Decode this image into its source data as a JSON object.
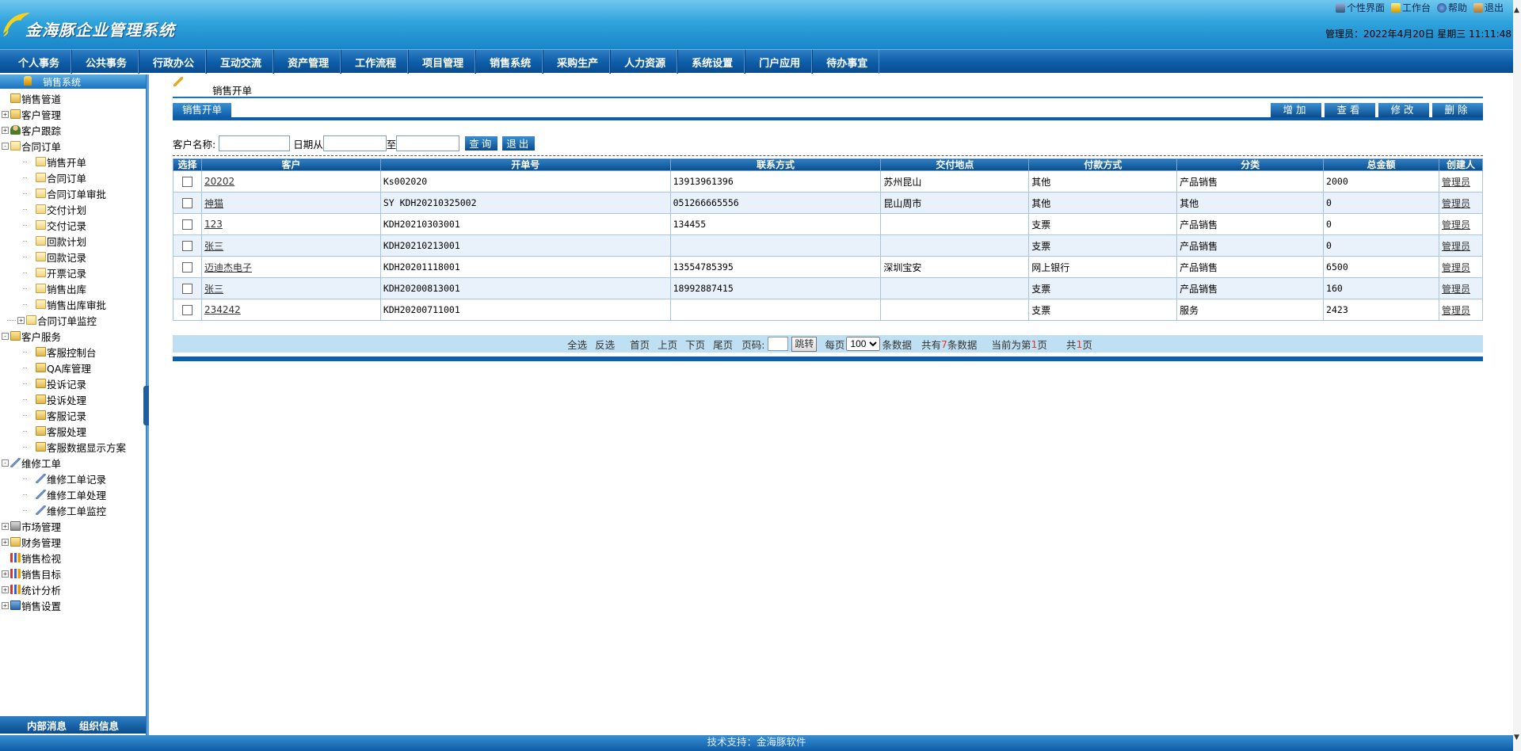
{
  "header": {
    "app_title": "金海豚企业管理系统",
    "toplinks": [
      {
        "label": "个性界面",
        "icon": "personalize-icon"
      },
      {
        "label": "工作台",
        "icon": "desk-icon"
      },
      {
        "label": "帮助",
        "icon": "help-icon"
      },
      {
        "label": "退出",
        "icon": "exit-icon"
      }
    ],
    "admin_line": "管理员：2022年4月20日 星期三 11:11:48"
  },
  "nav": [
    "个人事务",
    "公共事务",
    "行政办公",
    "互动交流",
    "资产管理",
    "工作流程",
    "项目管理",
    "销售系统",
    "采购生产",
    "人力资源",
    "系统设置",
    "门户应用",
    "待办事宜"
  ],
  "sidebar": {
    "title": "销售系统",
    "items": [
      {
        "label": "销售管道",
        "level": 0,
        "toggle": "",
        "icon": "folder"
      },
      {
        "label": "客户管理",
        "level": 0,
        "toggle": "+",
        "icon": "folder"
      },
      {
        "label": "客户跟踪",
        "level": 0,
        "toggle": "+",
        "icon": "user"
      },
      {
        "label": "合同订单",
        "level": 0,
        "toggle": "-",
        "icon": "doc"
      },
      {
        "label": "销售开单",
        "level": 2,
        "toggle": "",
        "icon": "doc"
      },
      {
        "label": "合同订单",
        "level": 2,
        "toggle": "",
        "icon": "doc"
      },
      {
        "label": "合同订单审批",
        "level": 2,
        "toggle": "",
        "icon": "doc"
      },
      {
        "label": "交付计划",
        "level": 2,
        "toggle": "",
        "icon": "doc"
      },
      {
        "label": "交付记录",
        "level": 2,
        "toggle": "",
        "icon": "doc"
      },
      {
        "label": "回款计划",
        "level": 2,
        "toggle": "",
        "icon": "doc"
      },
      {
        "label": "回款记录",
        "level": 2,
        "toggle": "",
        "icon": "doc"
      },
      {
        "label": "开票记录",
        "level": 2,
        "toggle": "",
        "icon": "doc"
      },
      {
        "label": "销售出库",
        "level": 2,
        "toggle": "",
        "icon": "doc"
      },
      {
        "label": "销售出库审批",
        "level": 2,
        "toggle": "",
        "icon": "doc"
      },
      {
        "label": "合同订单监控",
        "level": 1,
        "toggle": "+",
        "icon": "doc"
      },
      {
        "label": "客户服务",
        "level": 0,
        "toggle": "-",
        "icon": "folder"
      },
      {
        "label": "客服控制台",
        "level": 2,
        "toggle": "",
        "icon": "folder"
      },
      {
        "label": "QA库管理",
        "level": 2,
        "toggle": "",
        "icon": "folder"
      },
      {
        "label": "投诉记录",
        "level": 2,
        "toggle": "",
        "icon": "folder"
      },
      {
        "label": "投诉处理",
        "level": 2,
        "toggle": "",
        "icon": "folder"
      },
      {
        "label": "客服记录",
        "level": 2,
        "toggle": "",
        "icon": "folder"
      },
      {
        "label": "客服处理",
        "level": 2,
        "toggle": "",
        "icon": "folder"
      },
      {
        "label": "客服数据显示方案",
        "level": 2,
        "toggle": "",
        "icon": "folder"
      },
      {
        "label": "维修工单",
        "level": 0,
        "toggle": "-",
        "icon": "wrench"
      },
      {
        "label": "维修工单记录",
        "level": 2,
        "toggle": "",
        "icon": "wrench"
      },
      {
        "label": "维修工单处理",
        "level": 2,
        "toggle": "",
        "icon": "wrench"
      },
      {
        "label": "维修工单监控",
        "level": 2,
        "toggle": "",
        "icon": "wrench"
      },
      {
        "label": "市场管理",
        "level": 0,
        "toggle": "+",
        "icon": "lock"
      },
      {
        "label": "财务管理",
        "level": 0,
        "toggle": "+",
        "icon": "folder"
      },
      {
        "label": "销售检视",
        "level": 0,
        "toggle": "",
        "icon": "chart"
      },
      {
        "label": "销售目标",
        "level": 0,
        "toggle": "+",
        "icon": "chart"
      },
      {
        "label": "统计分析",
        "level": 0,
        "toggle": "+",
        "icon": "chart"
      },
      {
        "label": "销售设置",
        "level": 0,
        "toggle": "+",
        "icon": "cfg"
      }
    ],
    "footer": [
      "内部消息",
      "组织信息"
    ]
  },
  "main": {
    "heading": "销售开单",
    "tab": "销售开单",
    "actions": [
      "增加",
      "查看",
      "修改",
      "删除"
    ],
    "search": {
      "customer_label": "客户名称:",
      "date_from_label": "日期从",
      "date_to_label": "至",
      "query_btn": "查询",
      "exit_btn": "退出"
    },
    "columns": [
      "选择",
      "客户",
      "开单号",
      "联系方式",
      "交付地点",
      "付款方式",
      "分类",
      "总金额",
      "创建人"
    ],
    "rows": [
      {
        "customer": "20202",
        "order_no": "Ks002020",
        "contact": "13913961396",
        "location": "苏州昆山",
        "payment": "其他",
        "category": "产品销售",
        "amount": "2000",
        "creator": "管理员"
      },
      {
        "customer": "神猫",
        "order_no": "SY KDH20210325002",
        "contact": "051266665556",
        "location": "昆山周市",
        "payment": "其他",
        "category": "其他",
        "amount": "0",
        "creator": "管理员"
      },
      {
        "customer": "123",
        "order_no": "KDH20210303001",
        "contact": "134455",
        "location": "",
        "payment": "支票",
        "category": "产品销售",
        "amount": "0",
        "creator": "管理员"
      },
      {
        "customer": "张三",
        "order_no": "KDH20210213001",
        "contact": "",
        "location": "",
        "payment": "支票",
        "category": "产品销售",
        "amount": "0",
        "creator": "管理员"
      },
      {
        "customer": "迈迪杰电子",
        "order_no": "KDH20201118001",
        "contact": "13554785395",
        "location": "深圳宝安",
        "payment": "网上银行",
        "category": "产品销售",
        "amount": "6500",
        "creator": "管理员"
      },
      {
        "customer": "张三",
        "order_no": "KDH20200813001",
        "contact": "18992887415",
        "location": "",
        "payment": "支票",
        "category": "产品销售",
        "amount": "160",
        "creator": "管理员"
      },
      {
        "customer": "234242",
        "order_no": "KDH20200711001",
        "contact": "",
        "location": "",
        "payment": "支票",
        "category": "服务",
        "amount": "2423",
        "creator": "管理员"
      }
    ],
    "pager": {
      "select_all": "全选",
      "invert": "反选",
      "first": "首页",
      "prev": "上页",
      "next": "下页",
      "last": "尾页",
      "page_label": "页码:",
      "go_btn": "跳转",
      "per_page_label": "每页",
      "per_page_value": "100",
      "per_page_suffix": "条数据",
      "total_prefix": "共有",
      "total_count": "7",
      "total_suffix": "条数据",
      "current_prefix": "当前为第",
      "current_page": "1",
      "current_suffix": "页",
      "pages_prefix": "共",
      "pages_count": "1",
      "pages_suffix": "页"
    }
  },
  "footer": "技术支持：金海豚软件"
}
